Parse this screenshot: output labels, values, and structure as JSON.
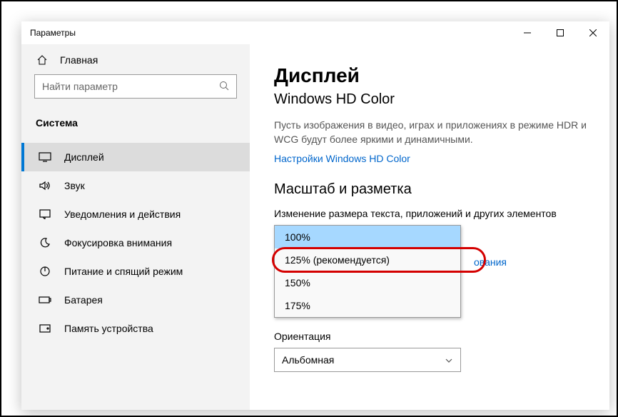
{
  "titlebar": {
    "title": "Параметры"
  },
  "sidebar": {
    "home": "Главная",
    "search_placeholder": "Найти параметр",
    "category": "Система",
    "items": [
      {
        "label": "Дисплей"
      },
      {
        "label": "Звук"
      },
      {
        "label": "Уведомления и действия"
      },
      {
        "label": "Фокусировка внимания"
      },
      {
        "label": "Питание и спящий режим"
      },
      {
        "label": "Батарея"
      },
      {
        "label": "Память устройства"
      }
    ]
  },
  "main": {
    "heading": "Дисплей",
    "subheading": "Windows HD Color",
    "desc": "Пусть изображения в видео, играх и приложениях в режиме HDR и WCG будут более яркими и динамичными.",
    "hd_link": "Настройки Windows HD Color",
    "scale_section": "Масштаб и разметка",
    "scale_label": "Изменение размера текста, приложений и других элементов",
    "scale_options": [
      "100%",
      "125% (рекомендуется)",
      "150%",
      "175%"
    ],
    "link_behind": "ования",
    "orientation_label": "Ориентация",
    "orientation_value": "Альбомная"
  }
}
